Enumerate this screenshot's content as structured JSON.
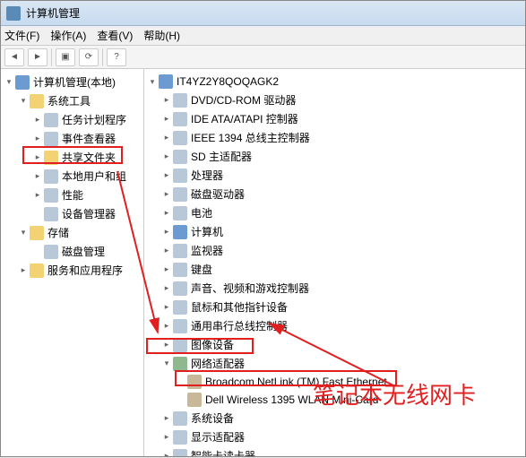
{
  "window": {
    "title": "计算机管理"
  },
  "menu": {
    "file": "文件(F)",
    "action": "操作(A)",
    "view": "查看(V)",
    "help": "帮助(H)"
  },
  "left_tree": {
    "root": "计算机管理(本地)",
    "system_tools": "系统工具",
    "task_scheduler": "任务计划程序",
    "event_viewer": "事件查看器",
    "shared_folders": "共享文件夹",
    "local_users": "本地用户和组",
    "performance": "性能",
    "device_manager": "设备管理器",
    "storage": "存储",
    "disk_mgmt": "磁盘管理",
    "services_apps": "服务和应用程序"
  },
  "right_tree": {
    "computer": "IT4YZ2Y8QOQAGK2",
    "dvd": "DVD/CD-ROM 驱动器",
    "ide": "IDE ATA/ATAPI 控制器",
    "ieee1394": "IEEE 1394 总线主控制器",
    "sd": "SD 主适配器",
    "cpu": "处理器",
    "disk": "磁盘驱动器",
    "battery": "电池",
    "computer_cat": "计算机",
    "monitor": "监视器",
    "keyboard": "键盘",
    "sound": "声音、视频和游戏控制器",
    "mouse": "鼠标和其他指针设备",
    "usb": "通用串行总线控制器",
    "imaging": "图像设备",
    "network": "网络适配器",
    "net_broadcom": "Broadcom NetLink (TM) Fast Ethernet",
    "net_dell": "Dell Wireless 1395 WLAN Mini-Card",
    "system_devices": "系统设备",
    "display": "显示适配器",
    "smartcard": "智能卡读卡器"
  },
  "annotation": {
    "label": "笔记本无线网卡"
  }
}
